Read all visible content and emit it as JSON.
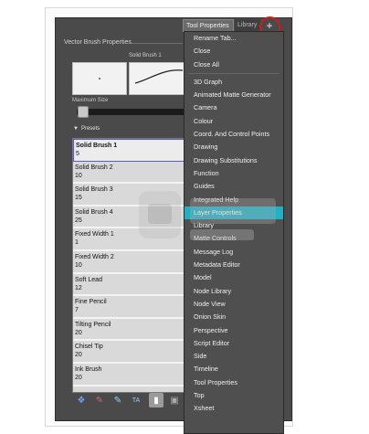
{
  "panel": {
    "title": "Vector Brush Properties",
    "preview_label": "Solid Brush 1",
    "max_size_label": "Maximum Size",
    "presets_label": "Presets",
    "max_size_fraction": 0.04
  },
  "presets": [
    {
      "name": "Solid Brush 1",
      "size": "5",
      "selected": true
    },
    {
      "name": "Solid Brush 2",
      "size": "10"
    },
    {
      "name": "Solid Brush 3",
      "size": "15"
    },
    {
      "name": "Solid Brush 4",
      "size": "25"
    },
    {
      "name": "Fixed Width 1",
      "size": "1"
    },
    {
      "name": "Fixed Width 2",
      "size": "10"
    },
    {
      "name": "Soft Lead",
      "size": "12"
    },
    {
      "name": "Fine Pencil",
      "size": "7"
    },
    {
      "name": "Tilting Pencil",
      "size": "20"
    },
    {
      "name": "Chisel Tip",
      "size": "20"
    },
    {
      "name": "Ink Brush",
      "size": "20"
    }
  ],
  "tabs": {
    "active": "Tool Properties",
    "inactive": "Library"
  },
  "add_button": "+",
  "menu": {
    "top_items": [
      "Rename Tab...",
      "Close",
      "Close All"
    ],
    "items": [
      "3D Graph",
      "Animated Matte Generator",
      "Camera",
      "Colour",
      "Coord. And Control Points",
      "Drawing",
      "Drawing Substitutions",
      "Function",
      "Guides",
      "Integrated Help",
      "Layer Properties",
      "Library",
      "Matte Controls",
      "Message Log",
      "Metadata Editor",
      "Model",
      "Node Library",
      "Node View",
      "Onion Skin",
      "Perspective",
      "Script Editor",
      "Side",
      "Timeline",
      "Tool Properties",
      "Top",
      "Xsheet"
    ],
    "highlighted": "Layer Properties"
  },
  "toolbar_icons": [
    "brush-mode-icon",
    "pencil-mode-icon",
    "eraser-mode-icon",
    "texture-icon",
    "pressure-icon",
    "lock-icon"
  ],
  "colors": {
    "highlight": "#23b0c4",
    "annotation": "#d11a1a",
    "selected_border": "#5a5ad8"
  }
}
